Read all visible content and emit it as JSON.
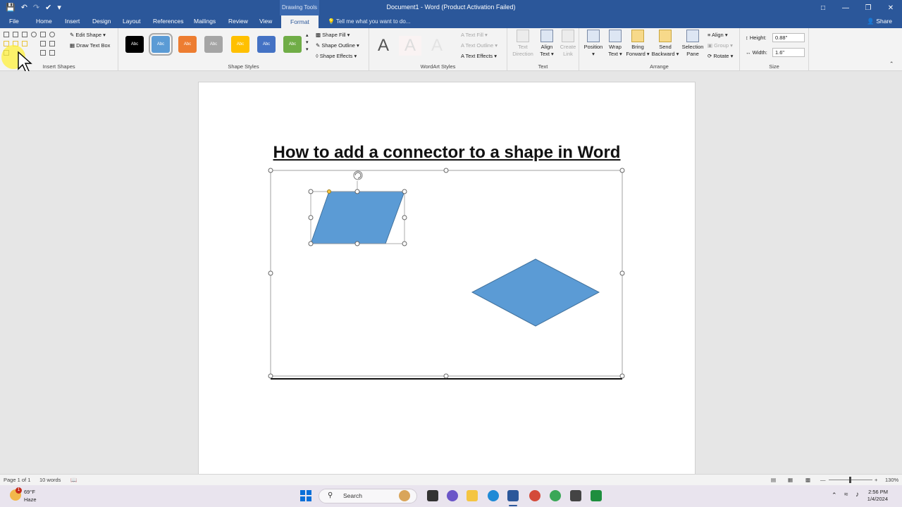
{
  "window": {
    "title": "Document1 - Word (Product Activation Failed)",
    "contextual_tab_group": "Drawing Tools"
  },
  "tabs": [
    "File",
    "Home",
    "Insert",
    "Design",
    "Layout",
    "References",
    "Mailings",
    "Review",
    "View",
    "Format"
  ],
  "active_tab": "Format",
  "tell_me_placeholder": "Tell me what you want to do...",
  "share_label": "Share",
  "ribbon": {
    "insert_shapes": {
      "label": "Insert Shapes",
      "edit_shape": "Edit Shape",
      "draw_text_box": "Draw Text Box"
    },
    "shape_styles": {
      "label": "Shape Styles",
      "swatches": [
        {
          "text": "Abc",
          "color": "#000000"
        },
        {
          "text": "Abc",
          "color": "#5b9bd5"
        },
        {
          "text": "Abc",
          "color": "#ed7d31"
        },
        {
          "text": "Abc",
          "color": "#a5a5a5"
        },
        {
          "text": "Abc",
          "color": "#ffc000"
        },
        {
          "text": "Abc",
          "color": "#4472c4"
        },
        {
          "text": "Abc",
          "color": "#70ad47"
        }
      ],
      "shape_fill": "Shape Fill",
      "shape_outline": "Shape Outline",
      "shape_effects": "Shape Effects"
    },
    "wordart_styles": {
      "label": "WordArt Styles",
      "letter": "A",
      "text_fill": "Text Fill",
      "text_outline": "Text Outline",
      "text_effects": "Text Effects"
    },
    "text": {
      "label": "Text",
      "text_direction": [
        "Text",
        "Direction"
      ],
      "align_text": [
        "Align",
        "Text"
      ],
      "create_link": [
        "Create",
        "Link"
      ]
    },
    "arrange": {
      "label": "Arrange",
      "position": "Position",
      "wrap_text": [
        "Wrap",
        "Text"
      ],
      "bring_forward": [
        "Bring",
        "Forward"
      ],
      "send_backward": [
        "Send",
        "Backward"
      ],
      "selection_pane": [
        "Selection",
        "Pane"
      ],
      "align": "Align",
      "group": "Group",
      "rotate": "Rotate"
    },
    "size": {
      "label": "Size",
      "height_label": "Height:",
      "height_value": "0.88\"",
      "width_label": "Width:",
      "width_value": "1.6\""
    }
  },
  "document": {
    "heading": "How to add a connector to a shape in Word",
    "shape_color": "#5b9bd5",
    "shape_stroke": "#41719c"
  },
  "status": {
    "page": "Page 1 of 1",
    "words": "10 words",
    "zoom": "130%"
  },
  "taskbar": {
    "weather_temp": "69°F",
    "weather_desc": "Haze",
    "weather_badge": "1",
    "search_label": "Search",
    "time": "2:56 PM",
    "date": "1/4/2024"
  }
}
